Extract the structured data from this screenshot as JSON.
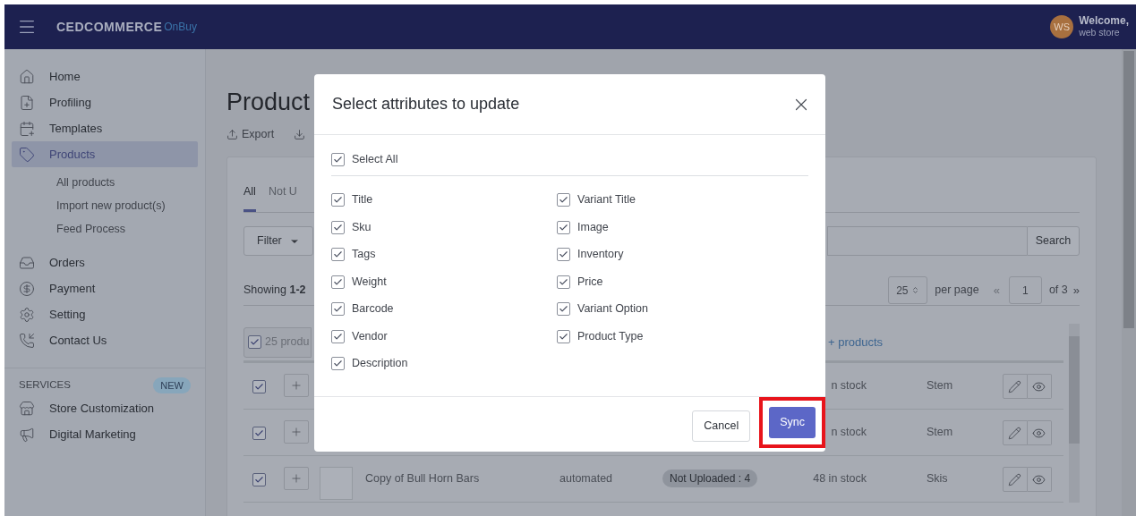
{
  "header": {
    "logo": "CEDCOMMERCE",
    "logo_suffix": "OnBuy",
    "avatar": "WS",
    "greeting": "Welcome,",
    "user": "web store"
  },
  "sidebar": {
    "items": [
      {
        "label": "Home",
        "selected": false
      },
      {
        "label": "Profiling",
        "selected": false
      },
      {
        "label": "Templates",
        "selected": false
      },
      {
        "label": "Products",
        "selected": true,
        "children": [
          {
            "label": "All products"
          },
          {
            "label": "Import new product(s)"
          },
          {
            "label": "Feed Process"
          }
        ]
      },
      {
        "label": "Orders",
        "selected": false
      },
      {
        "label": "Payment",
        "selected": false
      },
      {
        "label": "Setting",
        "selected": false
      },
      {
        "label": "Contact Us",
        "selected": false
      }
    ],
    "services": {
      "heading": "SERVICES",
      "badge": "NEW",
      "items": [
        {
          "label": "Store Customization"
        },
        {
          "label": "Digital Marketing"
        }
      ]
    }
  },
  "page": {
    "title": "Product",
    "export": "Export",
    "tabs": [
      {
        "label": "All",
        "selected": true
      },
      {
        "label": "Not U",
        "selected": false
      }
    ],
    "filter": "Filter",
    "search_button": "Search",
    "summary": "Showing **1-2**",
    "pagination": {
      "per_page_value": "25",
      "per_page_label": "per page",
      "prev": "«",
      "page": "1",
      "of": "of 3",
      "next": "»"
    },
    "bulk": {
      "checked": true,
      "label": "25 produ",
      "link": "+ products"
    },
    "rows": [
      {
        "checked": true,
        "stock": "n stock",
        "category": "Stem"
      },
      {
        "checked": true,
        "stock": "n stock",
        "category": "Stem"
      },
      {
        "checked": true,
        "thumbnail": true,
        "name": "Copy of Bull Horn Bars",
        "type": "automated",
        "status": "Not Uploaded : 4",
        "stock": "48 in stock",
        "category": "Skis"
      }
    ]
  },
  "modal": {
    "title": "Select attributes to update",
    "select_all": {
      "label": "Select All",
      "checked": true
    },
    "columns": [
      [
        {
          "label": "Title",
          "checked": true
        },
        {
          "label": "Sku",
          "checked": true
        },
        {
          "label": "Tags",
          "checked": true
        },
        {
          "label": "Weight",
          "checked": true
        },
        {
          "label": "Barcode",
          "checked": true
        },
        {
          "label": "Vendor",
          "checked": true
        },
        {
          "label": "Description",
          "checked": true
        }
      ],
      [
        {
          "label": "Variant Title",
          "checked": true
        },
        {
          "label": "Image",
          "checked": true
        },
        {
          "label": "Inventory",
          "checked": true
        },
        {
          "label": "Price",
          "checked": true
        },
        {
          "label": "Variant Option",
          "checked": true
        },
        {
          "label": "Product Type",
          "checked": true
        }
      ]
    ],
    "buttons": [
      {
        "label": "Cancel",
        "kind": "secondary",
        "highlighted": false
      },
      {
        "label": "Sync",
        "kind": "primary",
        "highlighted": true
      }
    ]
  }
}
